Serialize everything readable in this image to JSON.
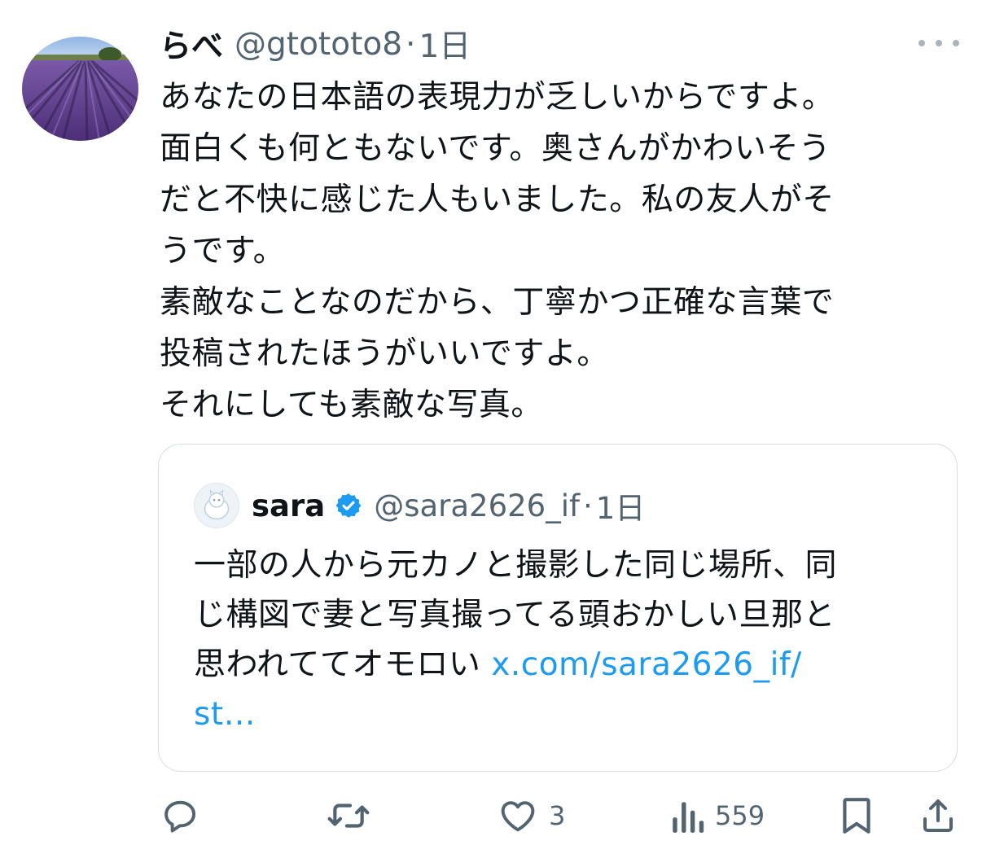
{
  "tweet": {
    "author": {
      "name": "らべ",
      "handle": "@gtototo8",
      "time": "1日",
      "separator": "·"
    },
    "text": "あなたの日本語の表現力が乏しいからですよ。\n面白くも何ともないです。奥さんがかわいそう\nだと不快に感じた人もいました。私の友人がそ\nうです。\n素敵なことなのだから、丁寧かつ正確な言葉で\n投稿されたほうがいいですよ。\nそれにしても素敵な写真。"
  },
  "quote": {
    "author": {
      "name": "sara",
      "handle": "@sara2626_if",
      "time": "1日",
      "separator": "·"
    },
    "text": "一部の人から元カノと撮影した同じ場所、同\nじ構図で妻と写真撮ってる頭おかしい旦那と\n思われててオモロい ",
    "link": "x.com/sara2626_if/\nst…"
  },
  "actions": {
    "reply": {
      "icon": "reply-icon"
    },
    "retweet": {
      "icon": "retweet-icon"
    },
    "like": {
      "icon": "heart-icon",
      "count": "3"
    },
    "views": {
      "icon": "views-icon",
      "count": "559"
    },
    "bookmark": {
      "icon": "bookmark-icon"
    },
    "share": {
      "icon": "share-icon"
    }
  },
  "colors": {
    "text": "#0f1419",
    "secondary": "#536471",
    "link": "#1d9bf0",
    "verified": "#1d9bf0",
    "border": "#d6dde3"
  }
}
